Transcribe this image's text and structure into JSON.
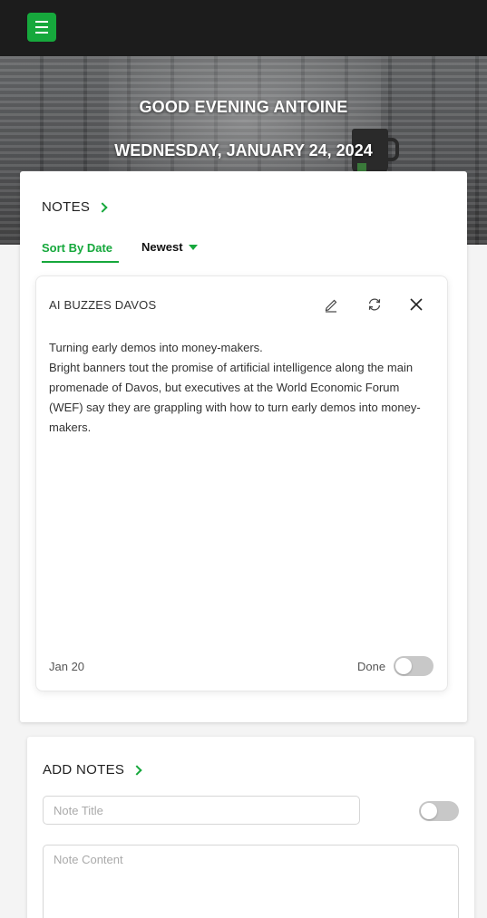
{
  "header": {
    "menu_icon": "hamburger-menu-icon",
    "accent": "#16a83c"
  },
  "hero": {
    "greeting": "GOOD EVENING ANTOINE",
    "date": "WEDNESDAY, JANUARY 24, 2024"
  },
  "notes": {
    "title": "NOTES",
    "sort_label": "Sort By Date",
    "order_label": "Newest",
    "items": [
      {
        "title": "AI BUZZES DAVOS",
        "body": [
          "Turning early demos into money-makers.",
          "Bright banners tout the promise of artificial intelligence along the main promenade of Davos, but executives at the World Economic Forum (WEF) say they are grappling with how to turn early demos into money-makers."
        ],
        "date": "Jan 20",
        "done_label": "Done",
        "done": false,
        "actions": [
          "edit-icon",
          "refresh-icon",
          "close-icon"
        ]
      }
    ]
  },
  "add_notes": {
    "title": "ADD NOTES",
    "title_placeholder": "Note Title",
    "content_placeholder": "Note Content",
    "toggle_on": false
  }
}
